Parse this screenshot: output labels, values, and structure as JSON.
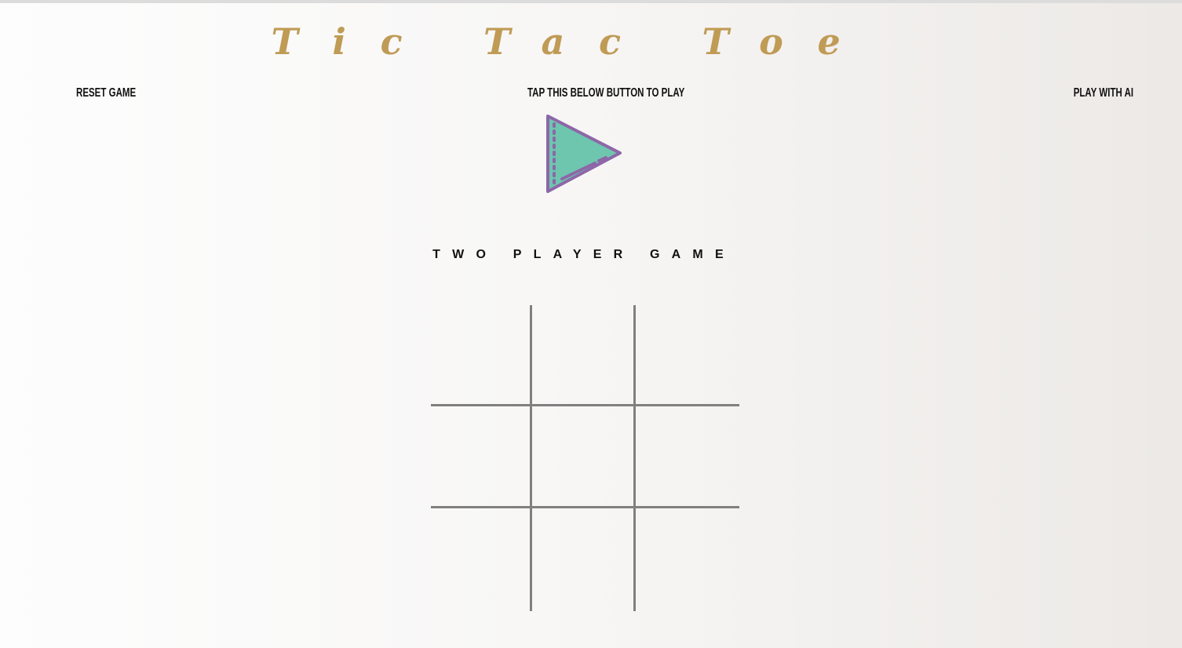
{
  "header": {
    "title": "Tic Tac Toe"
  },
  "nav": {
    "reset_label": "RESET GAME",
    "prompt_label": "TAP THIS BELOW BUTTON TO PLAY",
    "ai_label": "PLAY WITH AI"
  },
  "play_button": {
    "icon": "play-icon",
    "fill_color": "#6ec6ae",
    "stroke_color": "#8d67a8"
  },
  "mode": {
    "label": "TWO PLAYER GAME"
  },
  "board": {
    "cells": [
      "",
      "",
      "",
      "",
      "",
      "",
      "",
      "",
      ""
    ],
    "line_color": "#808080"
  },
  "colors": {
    "title": "#bf9b55",
    "text": "#111111"
  }
}
